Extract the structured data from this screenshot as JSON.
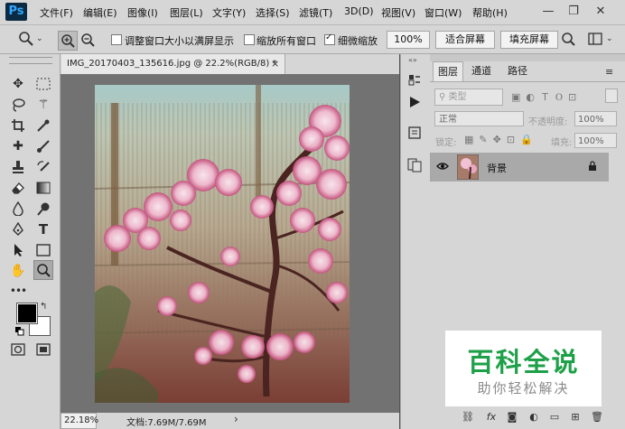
{
  "app": {
    "logo": "Ps"
  },
  "menu": [
    "文件(F)",
    "编辑(E)",
    "图像(I)",
    "图层(L)",
    "文字(Y)",
    "选择(S)",
    "滤镜(T)",
    "3D(D)",
    "视图(V)",
    "窗口(W)",
    "帮助(H)"
  ],
  "window_controls": {
    "minimize": "—",
    "restore": "❐",
    "close": "✕"
  },
  "options": {
    "resize_windows_label": "调整窗口大小以满屏显示",
    "resize_windows_checked": false,
    "zoom_all_label": "缩放所有窗口",
    "zoom_all_checked": false,
    "scrubby_zoom_label": "细微缩放",
    "scrubby_zoom_checked": true,
    "zoom_100_label": "100%",
    "fit_screen_label": "适合屏幕",
    "fill_screen_label": "填充屏幕"
  },
  "document": {
    "tab_title": "IMG_20170403_135616.jpg @ 22.2%(RGB/8) *",
    "close": "×"
  },
  "status": {
    "zoom": "22.18%",
    "doc_size": "文档:7.69M/7.69M",
    "arrow": "›"
  },
  "layers_panel": {
    "tabs": [
      "图层",
      "通道",
      "路径"
    ],
    "filter_kind": "类型",
    "blend_mode": "正常",
    "opacity_label": "不透明度:",
    "opacity_value": "100%",
    "lock_label": "锁定:",
    "fill_label": "填充:",
    "fill_value": "100%",
    "layers": [
      {
        "name": "背景",
        "visible": true,
        "locked": true
      }
    ]
  },
  "watermark": {
    "title": "百科全说",
    "subtitle": "助你轻松解决"
  }
}
